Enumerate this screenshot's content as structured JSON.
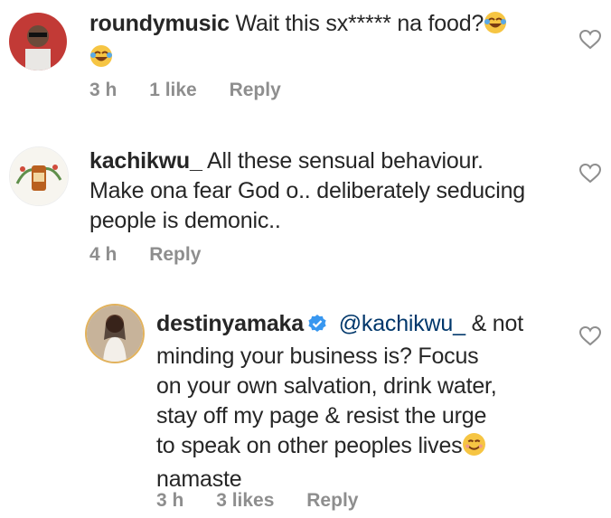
{
  "comments": [
    {
      "username": "roundymusic",
      "text": "Wait this sx***** na food?",
      "time": "3 h",
      "likes": "1 like",
      "reply_label": "Reply",
      "emoji": "laughing-tears-emoji"
    },
    {
      "username": "kachikwu_",
      "text_lines": [
        "All these sensual behaviour.",
        "Make ona fear God o.. deliberately seducing",
        "people is demonic.."
      ],
      "time": "4 h",
      "reply_label": "Reply"
    },
    {
      "username": "destinyamaka",
      "verified": true,
      "mention": "@kachikwu_",
      "text_first": "& not",
      "text_lines": [
        "minding your business is? Focus",
        "on your own salvation, drink water,",
        "stay off my page & resist the urge",
        "to speak on other peoples lives",
        "namaste"
      ],
      "time": "3 h",
      "likes": "3 likes",
      "reply_label": "Reply",
      "emoji": "smiling-emoji"
    }
  ],
  "colors": {
    "text": "#262626",
    "muted": "#8e8e8e",
    "mention": "#00376b",
    "verified": "#3897f0"
  }
}
